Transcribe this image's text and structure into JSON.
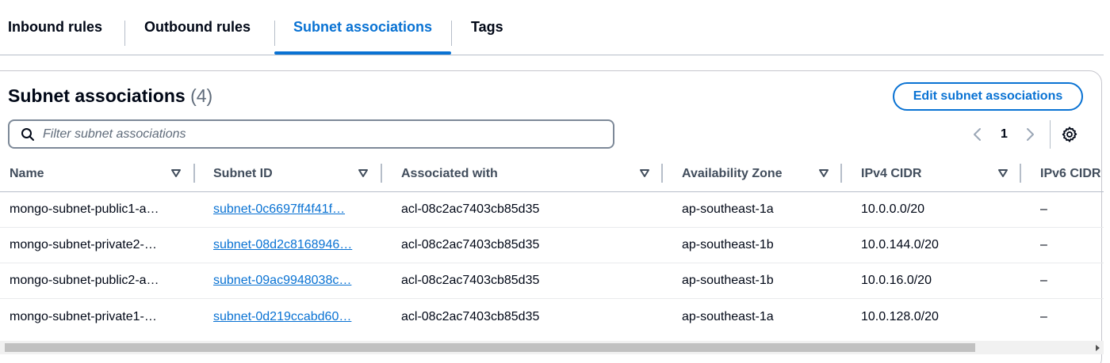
{
  "tabs": [
    {
      "label": "Inbound rules",
      "active": false
    },
    {
      "label": "Outbound rules",
      "active": false
    },
    {
      "label": "Subnet associations",
      "active": true
    },
    {
      "label": "Tags",
      "active": false
    }
  ],
  "section": {
    "title": "Subnet associations",
    "count": "(4)",
    "edit_button": "Edit subnet associations",
    "filter_placeholder": "Filter subnet associations"
  },
  "pagination": {
    "current_page": "1"
  },
  "table": {
    "columns": [
      "Name",
      "Subnet ID",
      "Associated with",
      "Availability Zone",
      "IPv4 CIDR",
      "IPv6 CIDR"
    ],
    "rows": [
      {
        "name": "mongo-subnet-public1-a…",
        "subnet_id": "subnet-0c6697ff4f41f…",
        "associated_with": "acl-08c2ac7403cb85d35",
        "az": "ap-southeast-1a",
        "ipv4": "10.0.0.0/20",
        "ipv6": "–"
      },
      {
        "name": "mongo-subnet-private2-…",
        "subnet_id": "subnet-08d2c8168946…",
        "associated_with": "acl-08c2ac7403cb85d35",
        "az": "ap-southeast-1b",
        "ipv4": "10.0.144.0/20",
        "ipv6": "–"
      },
      {
        "name": "mongo-subnet-public2-a…",
        "subnet_id": "subnet-09ac9948038c…",
        "associated_with": "acl-08c2ac7403cb85d35",
        "az": "ap-southeast-1b",
        "ipv4": "10.0.16.0/20",
        "ipv6": "–"
      },
      {
        "name": "mongo-subnet-private1-…",
        "subnet_id": "subnet-0d219ccabd60…",
        "associated_with": "acl-08c2ac7403cb85d35",
        "az": "ap-southeast-1a",
        "ipv4": "10.0.128.0/20",
        "ipv6": "–"
      }
    ]
  },
  "colors": {
    "accent": "#0972d3",
    "text": "#000716",
    "header_text": "#414d5c",
    "border": "#b6bec9"
  },
  "icons": {
    "search": "search-icon",
    "sort": "sort-down-icon",
    "prev": "chevron-left-icon",
    "next": "chevron-right-icon",
    "settings": "gear-icon"
  }
}
